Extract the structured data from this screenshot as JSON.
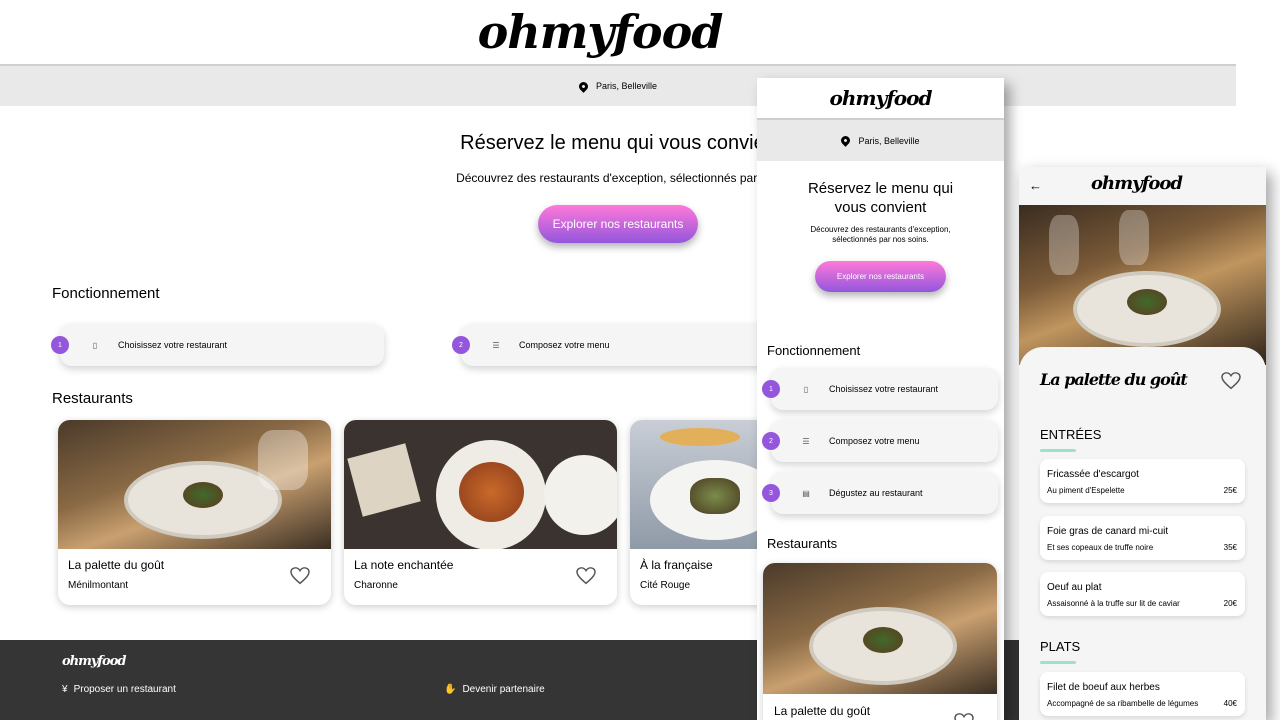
{
  "brand": "ohmyfood",
  "location": "Paris, Belleville",
  "hero": {
    "title": "Réservez le menu qui vous convient",
    "subtitle": "Découvrez des restaurants d'exception, sélectionnés par nos soins.",
    "subtitle_desktop_visible": "Découvrez des restaurants d'exception, sélectionnés par nos",
    "title_desktop_visible": "Réservez le menu qui vous convien",
    "tablet_title_line1": "Réservez le menu qui",
    "tablet_title_line2": "vous convient",
    "tablet_subtitle_line1": "Découvrez des restaurants d'exception,",
    "tablet_subtitle_line2": "sélectionnés par nos soins.",
    "cta": "Explorer nos restaurants"
  },
  "how_it_works": {
    "title": "Fonctionnement",
    "steps": [
      {
        "num": "1",
        "label": "Choisissez votre restaurant",
        "icon": "phone-icon"
      },
      {
        "num": "2",
        "label": "Composez votre menu",
        "icon": "list-icon"
      },
      {
        "num": "3",
        "label": "Dégustez au restaurant",
        "icon": "store-icon"
      }
    ]
  },
  "restaurants": {
    "title": "Restaurants",
    "items": [
      {
        "name": "La palette du goût",
        "location": "Ménilmontant"
      },
      {
        "name": "La note enchantée",
        "location": "Charonne"
      },
      {
        "name": "À la française",
        "location": "Cité Rouge"
      }
    ]
  },
  "footer": {
    "logo": "ohmyfood",
    "links": [
      {
        "label": "Proposer un restaurant",
        "icon": "cutlery-icon"
      },
      {
        "label": "Devenir partenaire",
        "icon": "handshake-icon"
      }
    ]
  },
  "menu_page": {
    "restaurant": "La palette du goût",
    "sections": [
      {
        "title": "ENTRÉES",
        "dishes": [
          {
            "name": "Fricassée d'escargot",
            "desc": "Au piment d'Espelette",
            "price": "25€"
          },
          {
            "name": "Foie gras de canard mi-cuit",
            "desc": "Et ses copeaux de truffe noire",
            "price": "35€"
          },
          {
            "name": "Oeuf au plat",
            "desc": "Assaisonné à la truffe sur lit de caviar",
            "price": "20€"
          }
        ]
      },
      {
        "title": "PLATS",
        "dishes": [
          {
            "name": "Filet de boeuf aux herbes",
            "desc": "Accompagné de sa ribambelle de légumes",
            "price": "40€"
          }
        ]
      }
    ]
  },
  "colors": {
    "accent_purple": "#9356dc",
    "accent_pink": "#ff79da",
    "mint": "#99e2d0",
    "footer_bg": "#353535"
  }
}
